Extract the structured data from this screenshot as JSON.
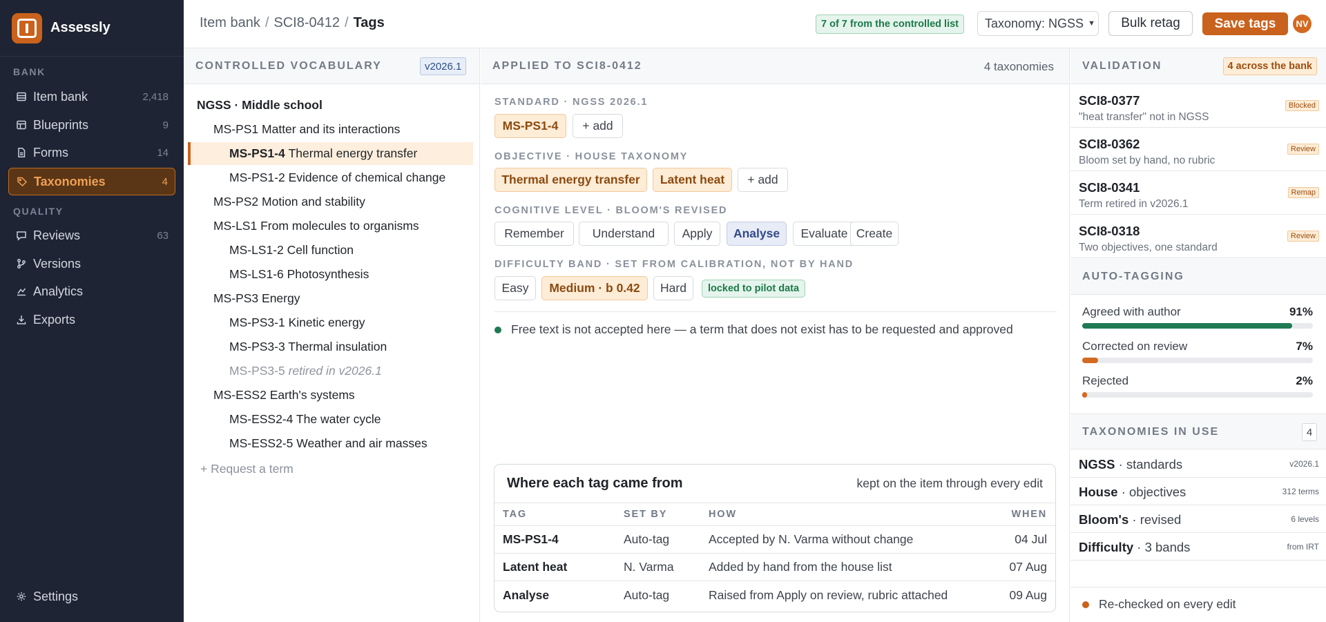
{
  "app": {
    "name": "Assessly"
  },
  "sidebar": {
    "sections": {
      "bank": "BANK",
      "quality": "QUALITY"
    },
    "items": [
      {
        "label": "Item bank",
        "count": "2,418",
        "icon": "list-icon"
      },
      {
        "label": "Blueprints",
        "count": "9",
        "icon": "grid-icon"
      },
      {
        "label": "Forms",
        "count": "14",
        "icon": "document-icon"
      },
      {
        "label": "Taxonomies",
        "count": "4",
        "icon": "tag-icon",
        "active": true
      },
      {
        "label": "Reviews",
        "count": "63",
        "icon": "comment-icon"
      },
      {
        "label": "Versions",
        "count": "",
        "icon": "branch-icon"
      },
      {
        "label": "Analytics",
        "count": "",
        "icon": "chart-icon"
      },
      {
        "label": "Exports",
        "count": "",
        "icon": "download-icon"
      }
    ],
    "settings": "Settings"
  },
  "header": {
    "breadcrumb": [
      "Item bank",
      "SCI8-0412",
      "Tags"
    ],
    "controlled_badge": "7 of 7 from the controlled list",
    "taxonomy_select": "Taxonomy: NGSS",
    "bulk_retag": "Bulk retag",
    "save_tags": "Save tags",
    "avatar_initials": "NV"
  },
  "vocab": {
    "title": "CONTROLLED VOCABULARY",
    "version": "v2026.1",
    "tree": [
      {
        "code": "",
        "label": "NGSS · Middle school",
        "level": 0
      },
      {
        "code": "",
        "label": "MS-PS1 Matter and its interactions",
        "level": 1
      },
      {
        "code": "MS-PS1-4",
        "label": "Thermal energy transfer",
        "level": 2,
        "selected": true
      },
      {
        "code": "",
        "label": "MS-PS1-2 Evidence of chemical change",
        "level": 2
      },
      {
        "code": "",
        "label": "MS-PS2 Motion and stability",
        "level": 1
      },
      {
        "code": "",
        "label": "MS-LS1 From molecules to organisms",
        "level": 1
      },
      {
        "code": "",
        "label": "MS-LS1-2 Cell function",
        "level": 2
      },
      {
        "code": "",
        "label": "MS-LS1-6 Photosynthesis",
        "level": 2
      },
      {
        "code": "",
        "label": "MS-PS3 Energy",
        "level": 1
      },
      {
        "code": "",
        "label": "MS-PS3-1 Kinetic energy",
        "level": 2
      },
      {
        "code": "",
        "label": "MS-PS3-3 Thermal insulation",
        "level": 2
      },
      {
        "code": "MS-PS3-5",
        "label": "retired in v2026.1",
        "level": 2,
        "retired": true
      },
      {
        "code": "",
        "label": "MS-ESS2 Earth's systems",
        "level": 1
      },
      {
        "code": "",
        "label": "MS-ESS2-4 The water cycle",
        "level": 2
      },
      {
        "code": "",
        "label": "MS-ESS2-5 Weather and air masses",
        "level": 2
      }
    ],
    "request": "Request a term"
  },
  "applied": {
    "title": "APPLIED TO SCI8-0412",
    "count": "4 taxonomies",
    "standard_label": "STANDARD · NGSS 2026.1",
    "standard_tags": [
      "MS-PS1-4"
    ],
    "add": "add",
    "objective_label": "OBJECTIVE · HOUSE TAXONOMY",
    "objective_tags": [
      "Thermal energy transfer",
      "Latent heat"
    ],
    "cognitive_label": "COGNITIVE LEVEL · BLOOM'S REVISED",
    "cognitive_levels": [
      "Remember",
      "Understand",
      "Apply",
      "Analyse",
      "Evaluate",
      "Create"
    ],
    "cognitive_selected": "Analyse",
    "difficulty_label": "DIFFICULTY BAND · SET FROM CALIBRATION, NOT BY HAND",
    "difficulty_bands": [
      "Easy",
      "Medium · b 0.42",
      "Hard"
    ],
    "difficulty_selected": "Medium · b 0.42",
    "locked": "locked to pilot data",
    "note": "Free text is not accepted here — a term that does not exist has to be requested and approved"
  },
  "provenance": {
    "title": "Where each tag came from",
    "subtitle": "kept on the item through every edit",
    "columns": [
      "TAG",
      "SET BY",
      "HOW",
      "WHEN"
    ],
    "rows": [
      {
        "tag": "MS-PS1-4",
        "by": "Auto-tag",
        "how": "Accepted by N. Varma without change",
        "when": "04 Jul"
      },
      {
        "tag": "Latent heat",
        "by": "N. Varma",
        "how": "Added by hand from the house list",
        "when": "07 Aug"
      },
      {
        "tag": "Analyse",
        "by": "Auto-tag",
        "how": "Raised from Apply on review, rubric attached",
        "when": "09 Aug"
      }
    ]
  },
  "validation": {
    "title": "VALIDATION",
    "badge": "4 across the bank",
    "items": [
      {
        "id": "SCI8-0377",
        "desc": "\"heat transfer\" not in NGSS",
        "status": "Blocked"
      },
      {
        "id": "SCI8-0362",
        "desc": "Bloom set by hand, no rubric",
        "status": "Review"
      },
      {
        "id": "SCI8-0341",
        "desc": "Term retired in v2026.1",
        "status": "Remap"
      },
      {
        "id": "SCI8-0318",
        "desc": "Two objectives, one standard",
        "status": "Review"
      }
    ]
  },
  "autotag": {
    "title": "AUTO-TAGGING",
    "metrics": [
      {
        "label": "Agreed with author",
        "pct": "91%",
        "value": 91,
        "color": "#1f7a53"
      },
      {
        "label": "Corrected on review",
        "pct": "7%",
        "value": 7,
        "color": "#d36a22"
      },
      {
        "label": "Rejected",
        "pct": "2%",
        "value": 2,
        "color": "#d36a22"
      }
    ]
  },
  "in_use": {
    "title": "TAXONOMIES IN USE",
    "count": "4",
    "items": [
      {
        "name": "NGSS",
        "kind": "· standards",
        "meta": "v2026.1"
      },
      {
        "name": "House",
        "kind": "· objectives",
        "meta": "312 terms"
      },
      {
        "name": "Bloom's",
        "kind": "· revised",
        "meta": "6 levels"
      },
      {
        "name": "Difficulty",
        "kind": "· 3 bands",
        "meta": "from IRT"
      }
    ],
    "footer": "Re-checked on every edit"
  }
}
